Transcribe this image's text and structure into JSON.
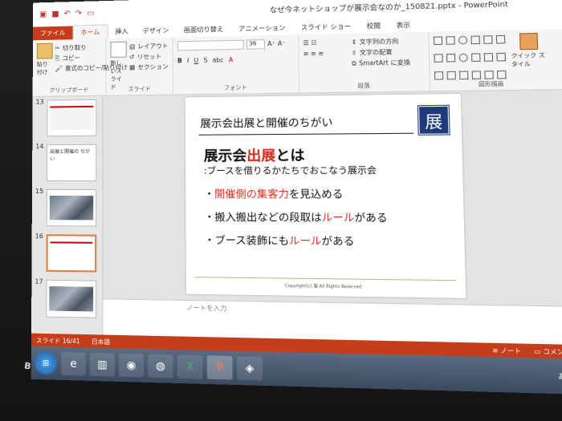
{
  "window": {
    "title": "なぜ今ネットショップが展示会なのか_150821.pptx - PowerPoint"
  },
  "tabs": [
    {
      "label": "ファイル"
    },
    {
      "label": "ホーム"
    },
    {
      "label": "挿入"
    },
    {
      "label": "デザイン"
    },
    {
      "label": "画面切り替え"
    },
    {
      "label": "アニメーション"
    },
    {
      "label": "スライド ショー"
    },
    {
      "label": "校閲"
    },
    {
      "label": "表示"
    }
  ],
  "ribbon": {
    "clipboard": {
      "paste": "貼り付け",
      "cut": "切り取り",
      "copy": "コピー",
      "format_painter": "書式のコピー/貼り付け",
      "label": "クリップボード"
    },
    "slides": {
      "new_slide": "新しいスライド",
      "layout": "レイアウト",
      "reset": "リセット",
      "section": "セクション",
      "label": "スライド"
    },
    "font": {
      "size": "36",
      "label": "フォント"
    },
    "paragraph": {
      "text_direction": "文字列の方向",
      "align_text": "文字の配置",
      "smartart": "SmartArt に変換",
      "label": "段落"
    },
    "drawing": {
      "quick_styles": "クイック スタイル",
      "label": "図形描画"
    }
  },
  "thumbnails": [
    {
      "num": "13",
      "text": ""
    },
    {
      "num": "14",
      "text": "出展と開催の ちがい"
    },
    {
      "num": "15",
      "text": ""
    },
    {
      "num": "16",
      "text": ""
    },
    {
      "num": "17",
      "text": ""
    }
  ],
  "slide": {
    "title": "展示会出展と開催のちがい",
    "logo_char": "展",
    "heading_pre": "展示会",
    "heading_red": "出展",
    "heading_post": "とは",
    "subline": ":ブースを借りるかたちでおこなう展示会",
    "bullets": [
      {
        "pre": "・",
        "red": "開催側の集客力",
        "post": "を見込める"
      },
      {
        "pre": "・搬入搬出などの段取は",
        "red": "ルール",
        "post": "がある"
      },
      {
        "pre": "・ブース装飾にも",
        "red": "ルール",
        "post": "がある"
      }
    ],
    "footer": "Copyright(c) 展 All Rights Reserved"
  },
  "notes": {
    "placeholder": "ノートを入力"
  },
  "statusbar": {
    "slide_info": "スライド 16/41",
    "language": "日本語",
    "notes": "ノート",
    "comments": "コメント"
  },
  "taskbar": {
    "apps": [
      "ie-icon",
      "explorer-icon",
      "chrome-icon",
      "firefox-icon",
      "excel-icon",
      "powerpoint-icon",
      "app-icon"
    ]
  },
  "colors": {
    "accent": "#c43e1c",
    "highlight_red": "#e0281c",
    "logo_blue": "#1f3a7a"
  }
}
